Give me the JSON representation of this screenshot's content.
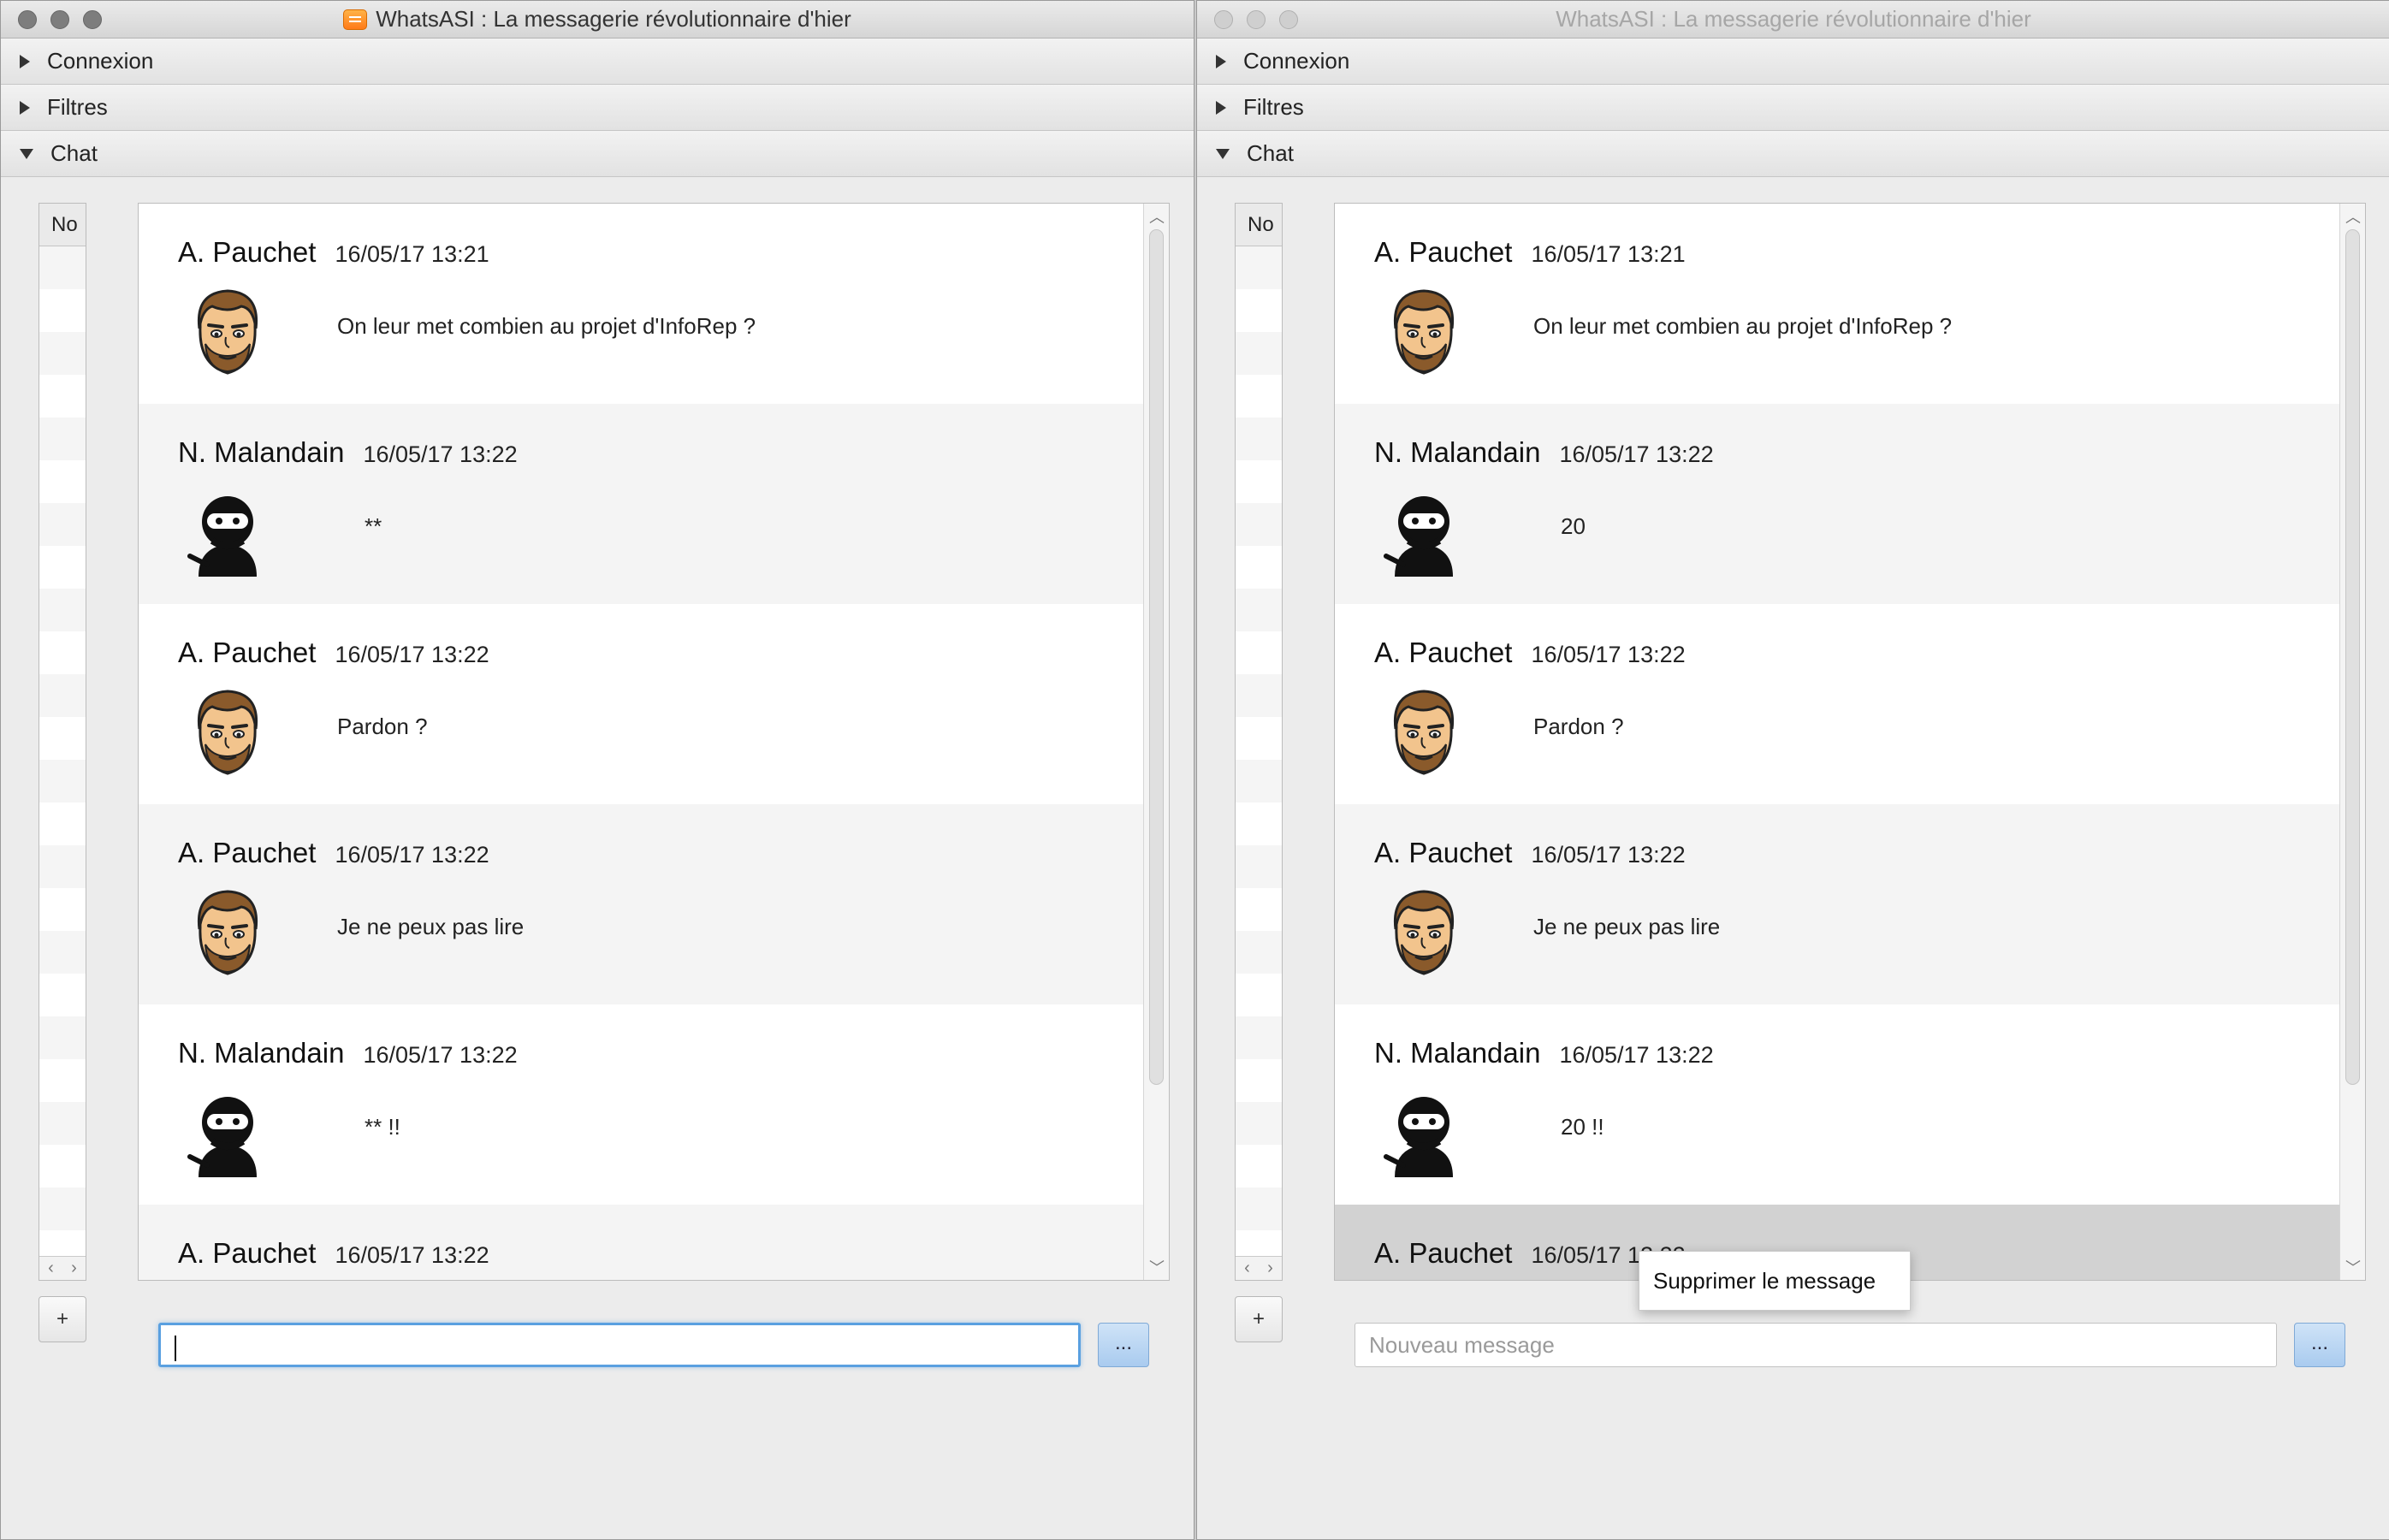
{
  "app": {
    "title": "WhatsASI : La messagerie révolutionnaire d'hier"
  },
  "panes": {
    "connexion": "Connexion",
    "filtres": "Filtres",
    "chat": "Chat"
  },
  "side_list": {
    "header": "No",
    "add_label": "+"
  },
  "left_window": {
    "messages": [
      {
        "author": "A. Pauchet",
        "time": "16/05/17 13:21",
        "avatar": "bearded-man-avatar",
        "text": "On leur met combien au projet d'InfoRep ?"
      },
      {
        "author": "N. Malandain",
        "time": "16/05/17 13:22",
        "avatar": "ninja-avatar",
        "text": "**"
      },
      {
        "author": "A. Pauchet",
        "time": "16/05/17 13:22",
        "avatar": "bearded-man-avatar",
        "text": "Pardon ?"
      },
      {
        "author": "A. Pauchet",
        "time": "16/05/17 13:22",
        "avatar": "bearded-man-avatar",
        "text": "Je ne peux pas lire"
      },
      {
        "author": "N. Malandain",
        "time": "16/05/17 13:22",
        "avatar": "ninja-avatar",
        "text": "** !!"
      },
      {
        "author": "A. Pauchet",
        "time": "16/05/17 13:22",
        "avatar": "bearded-man-avatar",
        "text": ""
      }
    ],
    "input_value": "",
    "send_label": "..."
  },
  "right_window": {
    "messages": [
      {
        "author": "A. Pauchet",
        "time": "16/05/17 13:21",
        "avatar": "bearded-man-avatar",
        "text": "On leur met combien au projet d'InfoRep ?"
      },
      {
        "author": "N. Malandain",
        "time": "16/05/17 13:22",
        "avatar": "ninja-avatar",
        "text": "20"
      },
      {
        "author": "A. Pauchet",
        "time": "16/05/17 13:22",
        "avatar": "bearded-man-avatar",
        "text": "Pardon ?"
      },
      {
        "author": "A. Pauchet",
        "time": "16/05/17 13:22",
        "avatar": "bearded-man-avatar",
        "text": "Je ne peux pas lire"
      },
      {
        "author": "N. Malandain",
        "time": "16/05/17 13:22",
        "avatar": "ninja-avatar",
        "text": "20 !!"
      },
      {
        "author": "A. Pauchet",
        "time": "16/05/17 13:22",
        "avatar": "bearded-man-avatar",
        "text": ""
      }
    ],
    "input_placeholder": "Nouveau message",
    "send_label": "...",
    "context_menu": {
      "item": "Supprimer le message"
    }
  },
  "colors": {
    "focus_ring": "#5aa0e0",
    "send_button": "#a9cbef",
    "selected_row": "#d2d2d2"
  }
}
